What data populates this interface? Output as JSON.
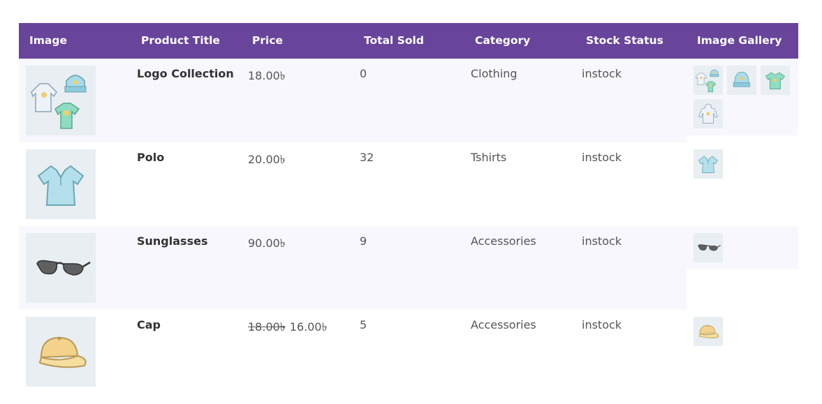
{
  "headers": [
    "Image",
    "Product Title",
    "Price",
    "Total Sold",
    "Category",
    "Stock Status",
    "Image Gallery"
  ],
  "colors": {
    "header_bg": "#68449b",
    "header_text": "#ffffff",
    "row_alt_bg": "#f8f7fe",
    "thumb_bg": "#e8eef2"
  },
  "products": [
    {
      "title": "Logo Collection",
      "price": "18.00৳",
      "old_price": "",
      "sold": "0",
      "category": "Clothing",
      "stock": "instock",
      "image": "clothing-bundle-icon",
      "gallery": [
        "clothing-bundle-icon",
        "beanie-icon",
        "tshirt-icon",
        "hoodie-icon"
      ]
    },
    {
      "title": "Polo",
      "price": "20.00৳",
      "old_price": "",
      "sold": "32",
      "category": "Tshirts",
      "stock": "instock",
      "image": "polo-shirt-icon",
      "gallery": [
        "polo-shirt-icon"
      ]
    },
    {
      "title": "Sunglasses",
      "price": "90.00৳",
      "old_price": "",
      "sold": "9",
      "category": "Accessories",
      "stock": "instock",
      "image": "sunglasses-icon",
      "gallery": [
        "sunglasses-icon"
      ]
    },
    {
      "title": "Cap",
      "price": "16.00৳",
      "old_price": "18.00৳",
      "sold": "5",
      "category": "Accessories",
      "stock": "instock",
      "image": "cap-icon",
      "gallery": [
        "cap-icon"
      ]
    }
  ]
}
